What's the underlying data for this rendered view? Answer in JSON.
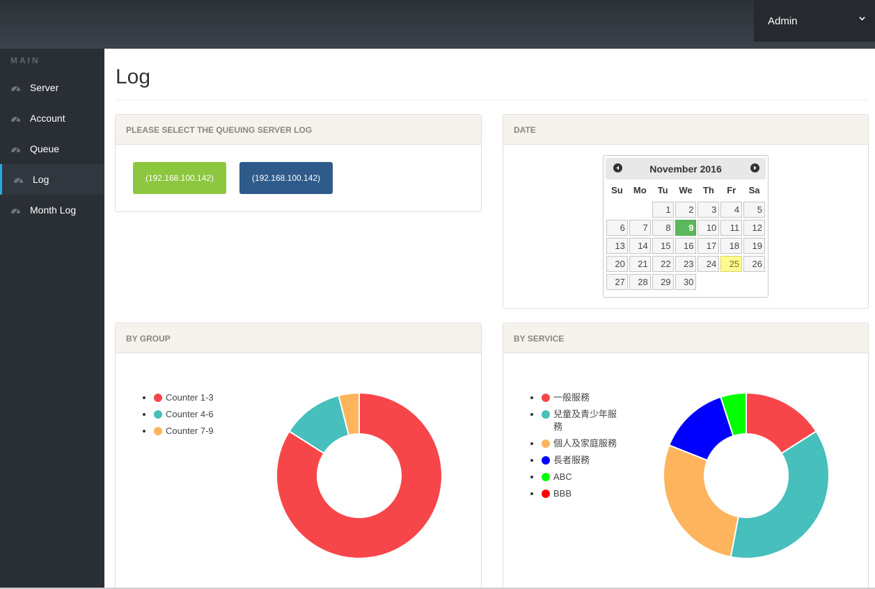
{
  "header": {
    "user_label": "Admin"
  },
  "sidebar": {
    "section": "MAIN",
    "items": [
      {
        "label": "Server",
        "icon": "dashboard-icon",
        "active": false
      },
      {
        "label": "Account",
        "icon": "dashboard-icon",
        "active": false
      },
      {
        "label": "Queue",
        "icon": "dashboard-icon",
        "active": false
      },
      {
        "label": "Log",
        "icon": "dashboard-icon",
        "active": true
      },
      {
        "label": "Month Log",
        "icon": "dashboard-icon",
        "active": false
      }
    ]
  },
  "page": {
    "title": "Log"
  },
  "server_panel": {
    "heading": "PLEASE SELECT THE QUEUING SERVER LOG",
    "buttons": [
      {
        "label": "(192.168.100.142)",
        "color": "#8dc63f"
      },
      {
        "label": "(192.168.100.142)",
        "color": "#2e5b8a"
      }
    ]
  },
  "date_panel": {
    "heading": "DATE",
    "calendar": {
      "month_label": "November 2016",
      "weekdays": [
        "Su",
        "Mo",
        "Tu",
        "We",
        "Th",
        "Fr",
        "Sa"
      ],
      "weeks": [
        [
          "",
          "",
          "1",
          "2",
          "3",
          "4",
          "5"
        ],
        [
          "6",
          "7",
          "8",
          "9",
          "10",
          "11",
          "12"
        ],
        [
          "13",
          "14",
          "15",
          "16",
          "17",
          "18",
          "19"
        ],
        [
          "20",
          "21",
          "22",
          "23",
          "24",
          "25",
          "26"
        ],
        [
          "27",
          "28",
          "29",
          "30",
          "",
          "",
          ""
        ]
      ],
      "selected_day": "9",
      "today_day": "25"
    }
  },
  "group_panel": {
    "heading": "BY GROUP",
    "legend": [
      {
        "label": "Counter 1-3",
        "color": "#f7464a"
      },
      {
        "label": "Counter 4-6",
        "color": "#46bfbd"
      },
      {
        "label": "Counter 7-9",
        "color": "#fdb45c"
      }
    ]
  },
  "service_panel": {
    "heading": "BY SERVICE",
    "legend": [
      {
        "label": "一般服務",
        "color": "#f7464a"
      },
      {
        "label": "兒童及青少年服務",
        "color": "#46bfbd"
      },
      {
        "label": "個人及家庭服務",
        "color": "#fdb45c"
      },
      {
        "label": "長者服務",
        "color": "#0000ff"
      },
      {
        "label": "ABC",
        "color": "#00ff00"
      },
      {
        "label": "BBB",
        "color": "#ff0000"
      }
    ]
  },
  "chart_data": [
    {
      "type": "pie",
      "donut": true,
      "categories": [
        "Counter 1-3",
        "Counter 4-6",
        "Counter 7-9"
      ],
      "values": [
        84,
        12,
        4
      ],
      "colors": [
        "#f7464a",
        "#46bfbd",
        "#fdb45c"
      ]
    },
    {
      "type": "pie",
      "donut": true,
      "categories": [
        "一般服務",
        "兒童及青少年服務",
        "個人及家庭服務",
        "長者服務",
        "ABC",
        "BBB"
      ],
      "values": [
        16,
        37,
        28,
        14,
        5,
        0
      ],
      "colors": [
        "#f7464a",
        "#46bfbd",
        "#fdb45c",
        "#0000ff",
        "#00ff00",
        "#ff0000"
      ]
    }
  ]
}
